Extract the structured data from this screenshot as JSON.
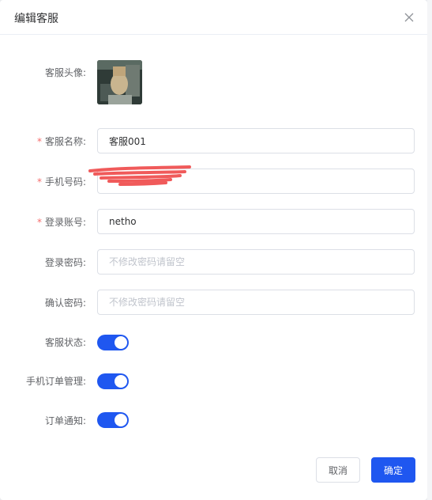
{
  "dialog": {
    "title": "编辑客服",
    "close_icon": "close-icon"
  },
  "form": {
    "avatar_label": "客服头像:",
    "name": {
      "label": "客服名称:",
      "required": true,
      "value": "客服001"
    },
    "phone": {
      "label": "手机号码:",
      "required": true,
      "value": ""
    },
    "account": {
      "label": "登录账号:",
      "required": true,
      "value": "netho"
    },
    "password": {
      "label": "登录密码:",
      "placeholder": "不修改密码请留空"
    },
    "confirm_password": {
      "label": "确认密码:",
      "placeholder": "不修改密码请留空"
    },
    "status": {
      "label": "客服状态:",
      "on": true
    },
    "mobile_order": {
      "label": "手机订单管理:",
      "on": true
    },
    "order_notify": {
      "label": "订单通知:",
      "on": true
    }
  },
  "footer": {
    "cancel_label": "取消",
    "confirm_label": "确定"
  },
  "colors": {
    "primary": "#1f57f0",
    "required": "#f56c6c",
    "redaction": "#f05a5a"
  }
}
